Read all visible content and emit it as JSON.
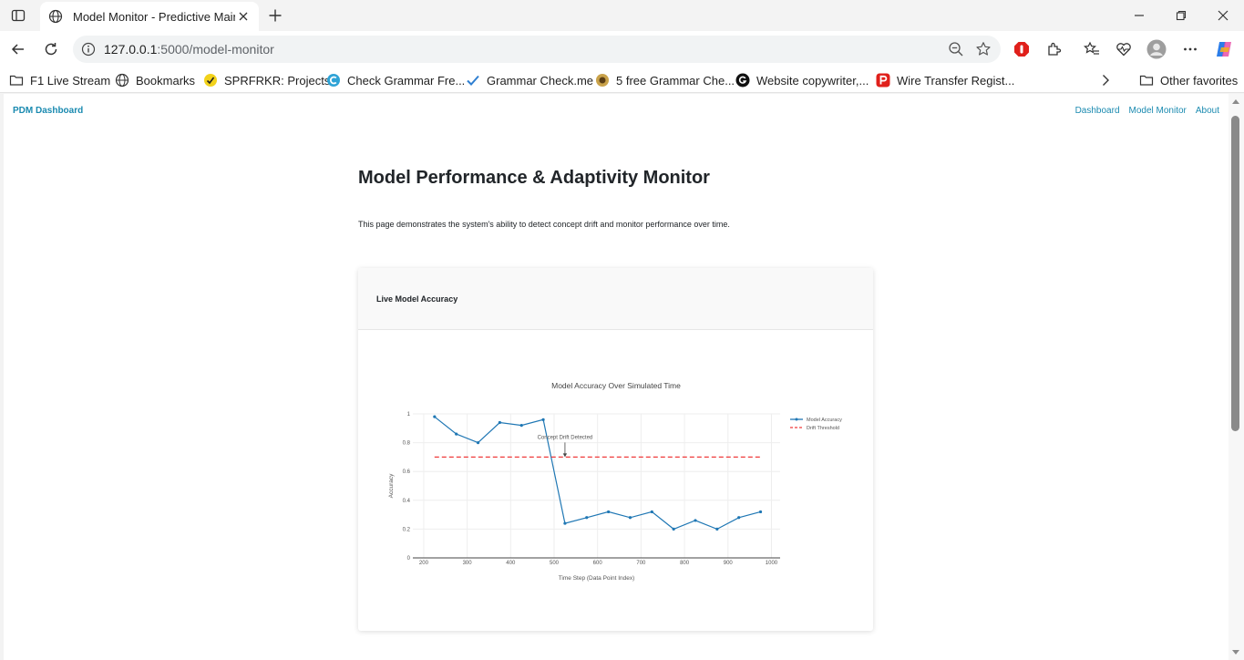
{
  "browser": {
    "tab_title": "Model Monitor - Predictive Maint",
    "url_host": "127.0.0.1",
    "url_rest": ":5000/model-monitor",
    "bookmarks": [
      {
        "label": "F1 Live Stream",
        "icon": "folder-icon"
      },
      {
        "label": "Bookmarks",
        "icon": "globe-icon"
      },
      {
        "label": "SPRFRKR: Projects",
        "icon": "sprfrkr-icon"
      },
      {
        "label": "Check Grammar Fre...",
        "icon": "grammar-c-icon"
      },
      {
        "label": "Grammar Check.me",
        "icon": "checkmark-icon"
      },
      {
        "label": "5 free Grammar Che...",
        "icon": "grammar-icon"
      },
      {
        "label": "Website copywriter,...",
        "icon": "g-letter-icon"
      },
      {
        "label": "Wire Transfer Regist...",
        "icon": "p-letter-icon"
      }
    ],
    "other_favorites": "Other favorites"
  },
  "site": {
    "brand": "PDM Dashboard",
    "nav": [
      "Dashboard",
      "Model Monitor",
      "About"
    ]
  },
  "page": {
    "title": "Model Performance & Adaptivity Monitor",
    "description": "This page demonstrates the system's ability to detect concept drift and monitor performance over time.",
    "card_title": "Live Model Accuracy"
  },
  "colors": {
    "accent": "#1a8ab0",
    "series_accuracy": "#1f77b4",
    "series_threshold": "#ef3b3b"
  },
  "chart_data": {
    "type": "line",
    "title": "Model Accuracy Over Simulated Time",
    "xlabel": "Time Step (Data Point Index)",
    "ylabel": "Accuracy",
    "xlim": [
      175,
      1020
    ],
    "ylim": [
      0,
      1.0
    ],
    "xticks": [
      200,
      300,
      400,
      500,
      600,
      700,
      800,
      900,
      1000
    ],
    "yticks": [
      0,
      0.2,
      0.4,
      0.6,
      0.8,
      1
    ],
    "grid": true,
    "legend": "right",
    "series": [
      {
        "name": "Model Accuracy",
        "style": "lines+markers",
        "x": [
          225,
          275,
          325,
          375,
          425,
          475,
          525,
          575,
          625,
          675,
          725,
          775,
          825,
          875,
          925,
          975
        ],
        "y": [
          0.98,
          0.86,
          0.8,
          0.94,
          0.92,
          0.96,
          0.24,
          0.28,
          0.32,
          0.28,
          0.32,
          0.2,
          0.26,
          0.2,
          0.28,
          0.32
        ]
      },
      {
        "name": "Drift Threshold",
        "style": "dash",
        "x": [
          225,
          975
        ],
        "y": [
          0.7,
          0.7
        ]
      }
    ],
    "annotations": [
      {
        "text": "Concept Drift Detected",
        "x": 525,
        "y": 0.7
      }
    ]
  }
}
